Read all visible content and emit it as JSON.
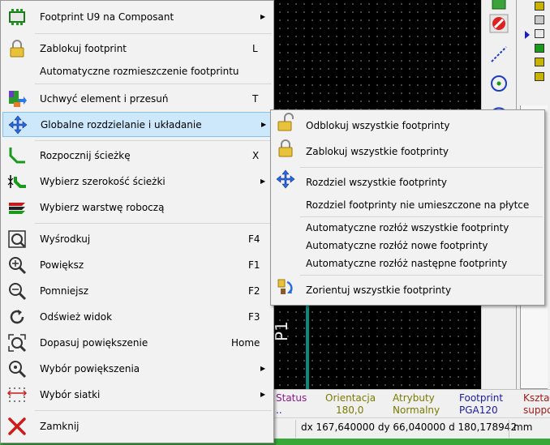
{
  "main_menu": {
    "items": [
      {
        "label": "Footprint U9 na Composant",
        "shortcut": "",
        "submenu": true,
        "icon": "footprint-icon"
      },
      {
        "label": "Zablokuj footprint",
        "shortcut": "L",
        "submenu": false,
        "icon": "lock-icon"
      },
      {
        "label": "Automatyczne rozmieszczenie footprintu",
        "shortcut": "",
        "submenu": false,
        "icon": ""
      },
      {
        "label": "Uchwyć element i przesuń",
        "shortcut": "T",
        "submenu": false,
        "icon": "grab-move-icon"
      },
      {
        "label": "Globalne rozdzielanie i układanie",
        "shortcut": "",
        "submenu": true,
        "icon": "move-arrows-icon"
      },
      {
        "label": "Rozpocznij ścieżkę",
        "shortcut": "X",
        "submenu": false,
        "icon": "track-icon"
      },
      {
        "label": "Wybierz szerokość ścieżki",
        "shortcut": "",
        "submenu": true,
        "icon": "track-width-icon"
      },
      {
        "label": "Wybierz warstwę roboczą",
        "shortcut": "",
        "submenu": false,
        "icon": "layers-icon"
      },
      {
        "label": "Wyśrodkuj",
        "shortcut": "F4",
        "submenu": false,
        "icon": "center-icon"
      },
      {
        "label": "Powiększ",
        "shortcut": "F1",
        "submenu": false,
        "icon": "zoom-in-icon"
      },
      {
        "label": "Pomniejsz",
        "shortcut": "F2",
        "submenu": false,
        "icon": "zoom-out-icon"
      },
      {
        "label": "Odśwież widok",
        "shortcut": "F3",
        "submenu": false,
        "icon": "refresh-icon"
      },
      {
        "label": "Dopasuj powiększenie",
        "shortcut": "Home",
        "submenu": false,
        "icon": "zoom-fit-icon"
      },
      {
        "label": "Wybór powiększenia",
        "shortcut": "",
        "submenu": true,
        "icon": "zoom-select-icon"
      },
      {
        "label": "Wybór siatki",
        "shortcut": "",
        "submenu": true,
        "icon": "grid-icon"
      },
      {
        "label": "Zamknij",
        "shortcut": "",
        "submenu": false,
        "icon": "close-icon"
      }
    ]
  },
  "sub_menu": {
    "items": [
      {
        "label": "Odblokuj wszystkie footprinty",
        "icon": "unlock-icon"
      },
      {
        "label": "Zablokuj wszystkie footprinty",
        "icon": "lock-icon"
      },
      {
        "label": "Rozdziel wszystkie footprinty",
        "icon": "move-arrows-icon"
      },
      {
        "label": "Rozdziel footprinty nie umieszczone na płytce",
        "icon": ""
      },
      {
        "label": "Automatyczne rozłóż wszystkie footprinty",
        "icon": ""
      },
      {
        "label": "Automatyczne rozłóż nowe footprinty",
        "icon": ""
      },
      {
        "label": "Automatyczne rozłóż następne footprinty",
        "icon": ""
      },
      {
        "label": "Zorientuj wszystkie footprinty",
        "icon": "orient-icon"
      }
    ]
  },
  "canvas": {
    "label": "P1"
  },
  "message_panel": {
    "status": {
      "header": "Status",
      "value": ".."
    },
    "orientation": {
      "header": "Orientacja",
      "value": "180,0"
    },
    "attributes": {
      "header": "Atrybuty",
      "value": "Normalny"
    },
    "footprint": {
      "header": "Footprint",
      "value": "PGA120"
    },
    "shape": {
      "header": "Kształt",
      "value": "suppo"
    }
  },
  "status_bar": {
    "coords": "dx 167,640000  dy 66,040000  d 180,178942",
    "units": "mm"
  },
  "colors": {
    "highlight_bg": "#cde8fb",
    "highlight_border": "#83c3f2",
    "msg_header_purple": "#8a1a8a",
    "msg_header_olive": "#7a7a00",
    "msg_header_blue": "#1a1aa0",
    "msg_header_red": "#a01a1a"
  }
}
